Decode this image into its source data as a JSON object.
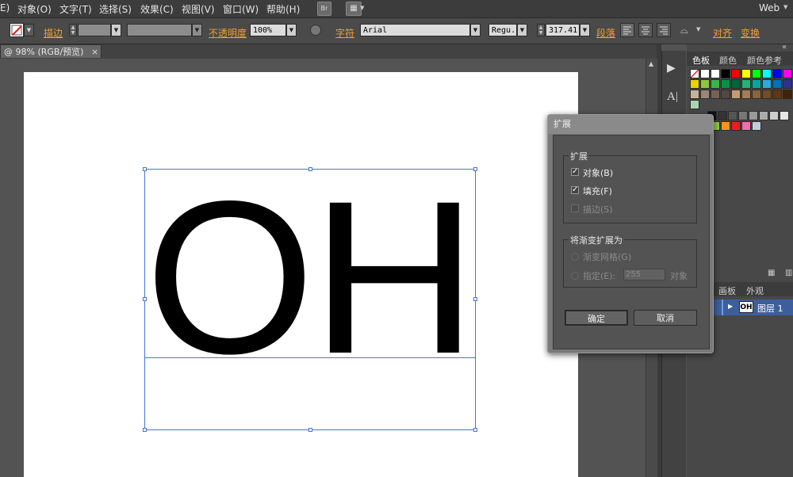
{
  "menu": {
    "items": [
      "E)",
      "对象(O)",
      "文字(T)",
      "选择(S)",
      "效果(C)",
      "视图(V)",
      "窗口(W)",
      "帮助(H)"
    ],
    "br": "Br",
    "workspace": "Web"
  },
  "control": {
    "stroke_label": "描边",
    "opacity_label": "不透明度",
    "opacity_value": "100%",
    "char_label": "字符",
    "font_value": "Arial",
    "style_value": "Regu...",
    "size_value": "317.41",
    "para_label": "段落",
    "align_label": "对齐",
    "transform_label": "变换"
  },
  "document": {
    "tab_label": "@ 98% (RGB/预览)",
    "tab_close": "×",
    "text": [
      "O",
      "H"
    ]
  },
  "panels": {
    "tabs": [
      "色板",
      "颜色",
      "颜色参考"
    ],
    "layer_tabs": [
      "画板",
      "外观"
    ],
    "layer_name": "图层 1",
    "layer_thumb": "OH",
    "collapse": "«"
  },
  "dialog": {
    "title": "扩展",
    "group1_title": "扩展",
    "object_label": "对象(B)",
    "fill_label": "填充(F)",
    "stroke_label": "描边(S)",
    "group2_title": "将渐变扩展为",
    "mesh_label": "渐变网格(G)",
    "specify_label": "指定(E):",
    "specify_value": "255",
    "objects_suffix": "对象",
    "ok_label": "确定",
    "cancel_label": "取消",
    "check_mark": "✓"
  },
  "colors": {
    "accent_orange": "#f0a030",
    "selection_blue": "#4a74d9",
    "layer_blue": "#3d5e9c"
  }
}
